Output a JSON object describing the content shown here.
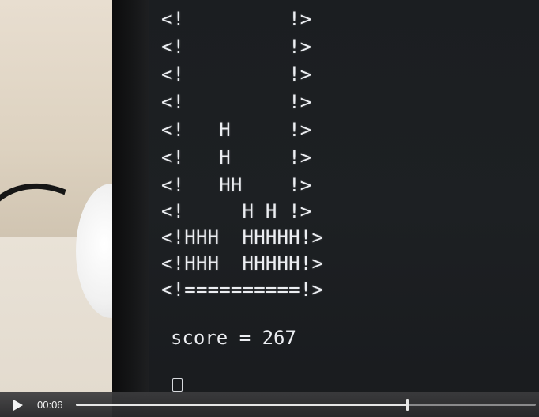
{
  "game": {
    "board_rows": [
      "<!         !>",
      "<!         !>",
      "<!         !>",
      "<!         !>",
      "<!   H     !>",
      "<!   H     !>",
      "<!   HH    !>",
      "<!     H H !>",
      "<!HHH  HHHHH!>",
      "<!HHH  HHHHH!>",
      "<!==========!>"
    ],
    "score_text": "score = 267"
  },
  "player": {
    "play_icon": "play-icon",
    "current_time": "00:06",
    "progress_fraction": 0.72
  },
  "colors": {
    "terminal_text": "#eceef2",
    "terminal_bg": "#1d2023",
    "control_bar": "#3a3a3c"
  }
}
